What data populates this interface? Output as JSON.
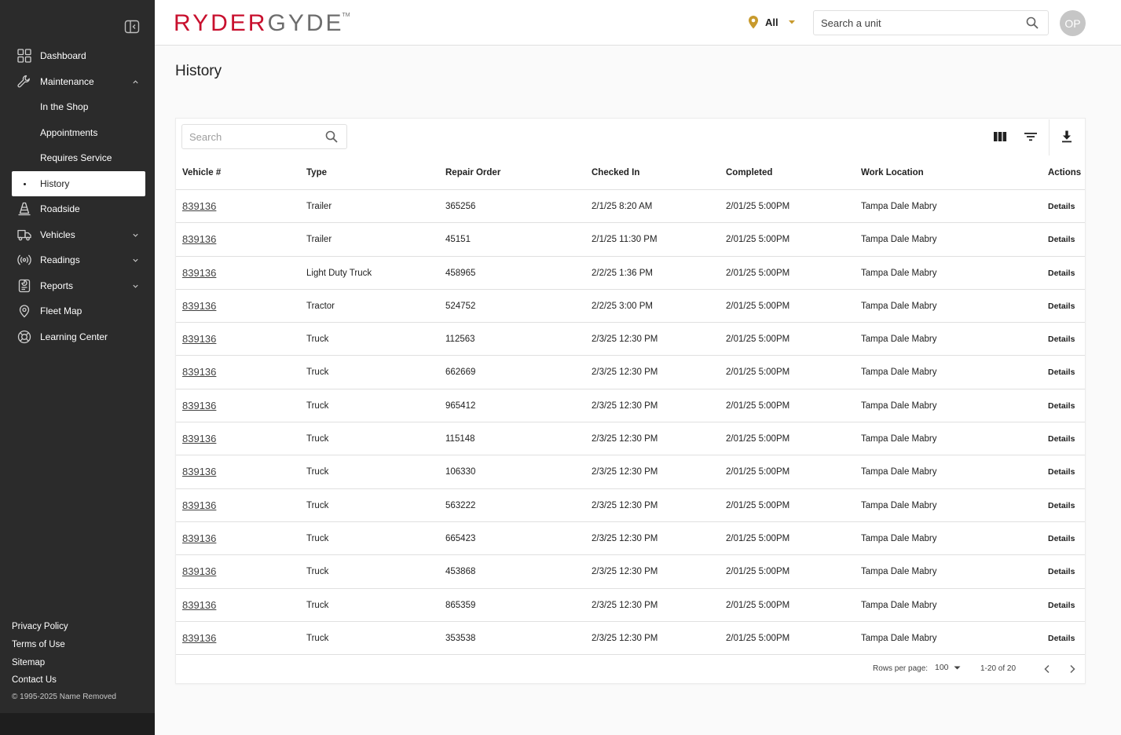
{
  "app": {
    "logo_part1": "RYDER",
    "logo_part2": "GYDE",
    "logo_tm": "TM",
    "brand_red": "#c8102e",
    "sidebar_bg": "#2b2b2b"
  },
  "sidebar": {
    "items": [
      {
        "label": "Dashboard",
        "icon": "grid-icon"
      },
      {
        "label": "Maintenance",
        "icon": "wrench-icon",
        "expanded": true
      },
      {
        "label": "In the Shop"
      },
      {
        "label": "Appointments"
      },
      {
        "label": "Requires Service"
      },
      {
        "label": "History",
        "active": true
      },
      {
        "label": "Roadside",
        "icon": "cone-icon"
      },
      {
        "label": "Vehicles",
        "icon": "truck-icon"
      },
      {
        "label": "Readings",
        "icon": "signal-icon"
      },
      {
        "label": "Reports",
        "icon": "report-icon"
      },
      {
        "label": "Fleet Map",
        "icon": "location-pin-icon"
      },
      {
        "label": "Learning Center",
        "icon": "lifebuoy-icon"
      }
    ],
    "footer": [
      "Privacy Policy",
      "Terms of Use",
      "Sitemap",
      "Contact Us"
    ],
    "copyright": "© 1995-2025 Name Removed"
  },
  "topbar": {
    "location_filter": "All",
    "search_placeholder": "Search a unit",
    "avatar_initials": "OP"
  },
  "page": {
    "title": "History"
  },
  "table": {
    "search_placeholder": "Search",
    "columns": [
      "Vehicle #",
      "Type",
      "Repair Order",
      "Checked In",
      "Completed",
      "Work Location",
      "Actions"
    ],
    "rows": [
      {
        "vehicle": "839136",
        "type": "Trailer",
        "repair_order": "365256",
        "checked_in": "2/1/25 8:20 AM",
        "completed": "2/01/25 5:00PM",
        "location": "Tampa Dale Mabry",
        "action": "Details"
      },
      {
        "vehicle": "839136",
        "type": "Trailer",
        "repair_order": "45151",
        "checked_in": "2/1/25 11:30 PM",
        "completed": "2/01/25 5:00PM",
        "location": "Tampa Dale Mabry",
        "action": "Details"
      },
      {
        "vehicle": "839136",
        "type": "Light Duty Truck",
        "repair_order": "458965",
        "checked_in": "2/2/25 1:36 PM",
        "completed": "2/01/25 5:00PM",
        "location": "Tampa Dale Mabry",
        "action": "Details"
      },
      {
        "vehicle": "839136",
        "type": "Tractor",
        "repair_order": "524752",
        "checked_in": "2/2/25 3:00 PM",
        "completed": "2/01/25 5:00PM",
        "location": "Tampa Dale Mabry",
        "action": "Details"
      },
      {
        "vehicle": "839136",
        "type": "Truck",
        "repair_order": "112563",
        "checked_in": "2/3/25 12:30 PM",
        "completed": "2/01/25 5:00PM",
        "location": "Tampa Dale Mabry",
        "action": "Details"
      },
      {
        "vehicle": "839136",
        "type": "Truck",
        "repair_order": "662669",
        "checked_in": "2/3/25 12:30 PM",
        "completed": "2/01/25 5:00PM",
        "location": "Tampa Dale Mabry",
        "action": "Details"
      },
      {
        "vehicle": "839136",
        "type": "Truck",
        "repair_order": "965412",
        "checked_in": "2/3/25 12:30 PM",
        "completed": "2/01/25 5:00PM",
        "location": "Tampa Dale Mabry",
        "action": "Details"
      },
      {
        "vehicle": "839136",
        "type": "Truck",
        "repair_order": "115148",
        "checked_in": "2/3/25 12:30 PM",
        "completed": "2/01/25 5:00PM",
        "location": "Tampa Dale Mabry",
        "action": "Details"
      },
      {
        "vehicle": "839136",
        "type": "Truck",
        "repair_order": "106330",
        "checked_in": "2/3/25 12:30 PM",
        "completed": "2/01/25 5:00PM",
        "location": "Tampa Dale Mabry",
        "action": "Details"
      },
      {
        "vehicle": "839136",
        "type": "Truck",
        "repair_order": "563222",
        "checked_in": "2/3/25 12:30 PM",
        "completed": "2/01/25 5:00PM",
        "location": "Tampa Dale Mabry",
        "action": "Details"
      },
      {
        "vehicle": "839136",
        "type": "Truck",
        "repair_order": "665423",
        "checked_in": "2/3/25 12:30 PM",
        "completed": "2/01/25 5:00PM",
        "location": "Tampa Dale Mabry",
        "action": "Details"
      },
      {
        "vehicle": "839136",
        "type": "Truck",
        "repair_order": "453868",
        "checked_in": "2/3/25 12:30 PM",
        "completed": "2/01/25 5:00PM",
        "location": "Tampa Dale Mabry",
        "action": "Details"
      },
      {
        "vehicle": "839136",
        "type": "Truck",
        "repair_order": "865359",
        "checked_in": "2/3/25 12:30 PM",
        "completed": "2/01/25 5:00PM",
        "location": "Tampa Dale Mabry",
        "action": "Details"
      },
      {
        "vehicle": "839136",
        "type": "Truck",
        "repair_order": "353538",
        "checked_in": "2/3/25 12:30 PM",
        "completed": "2/01/25 5:00PM",
        "location": "Tampa Dale Mabry",
        "action": "Details"
      }
    ],
    "pagination": {
      "rows_per_page_label": "Rows per page:",
      "rows_per_page": "100",
      "range": "1-20 of 20"
    }
  }
}
